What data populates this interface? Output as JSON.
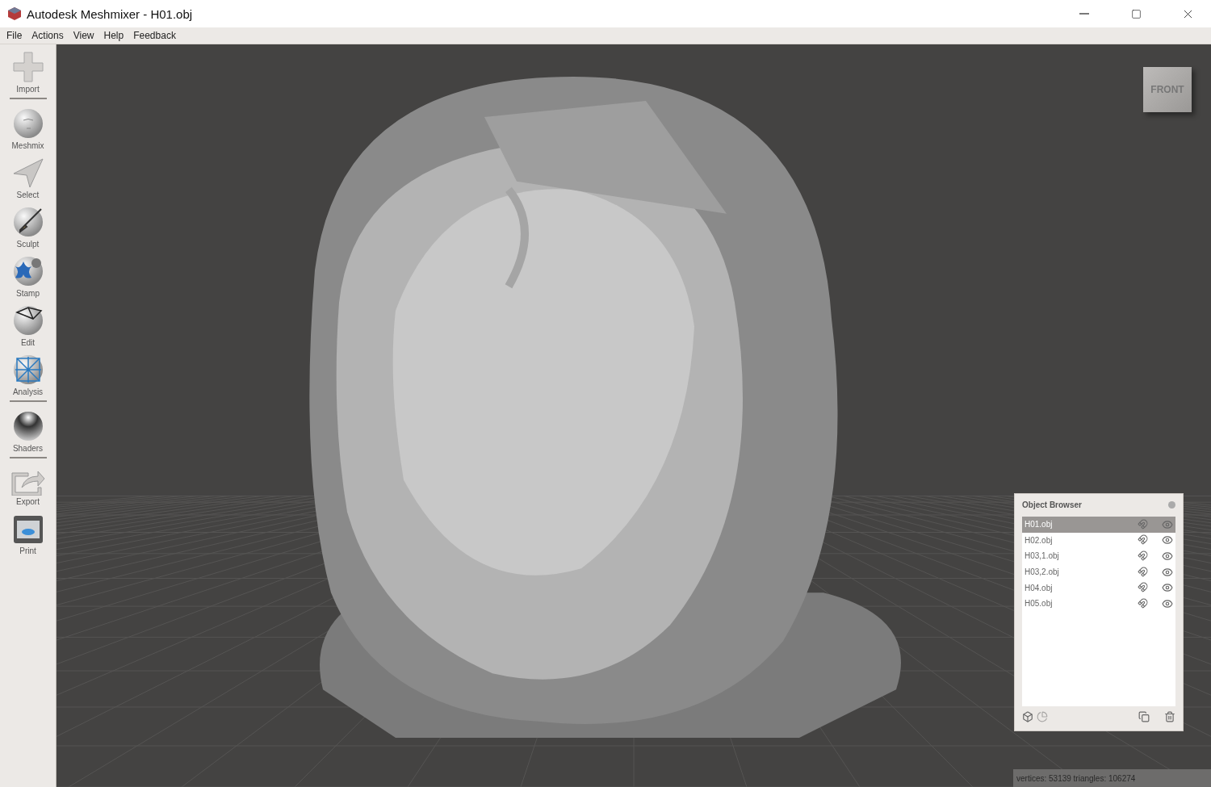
{
  "window": {
    "title": "Autodesk Meshmixer - H01.obj"
  },
  "menu": [
    "File",
    "Actions",
    "View",
    "Help",
    "Feedback"
  ],
  "tool_groups": [
    [
      {
        "kind": "import",
        "label": "Import"
      }
    ],
    [
      {
        "kind": "meshmix",
        "label": "Meshmix"
      },
      {
        "kind": "select",
        "label": "Select"
      },
      {
        "kind": "sculpt",
        "label": "Sculpt"
      },
      {
        "kind": "stamp",
        "label": "Stamp"
      },
      {
        "kind": "edit",
        "label": "Edit"
      },
      {
        "kind": "analysis",
        "label": "Analysis"
      }
    ],
    [
      {
        "kind": "shaders",
        "label": "Shaders"
      }
    ],
    [
      {
        "kind": "export",
        "label": "Export"
      },
      {
        "kind": "print",
        "label": "Print"
      }
    ]
  ],
  "viewport": {
    "kind": "picture",
    "view_cube": "FRONT"
  },
  "object_browser": {
    "title": "Object Browser",
    "objects": [
      {
        "name": "H01.obj",
        "selected": true
      },
      {
        "name": "H02.obj",
        "selected": false
      },
      {
        "name": "H03,1.obj",
        "selected": false
      },
      {
        "name": "H03,2.obj",
        "selected": false
      },
      {
        "name": "H04.obj",
        "selected": false
      },
      {
        "name": "H05.obj",
        "selected": false
      }
    ]
  },
  "status_bar": "vertices: 53139 triangles: 106274"
}
